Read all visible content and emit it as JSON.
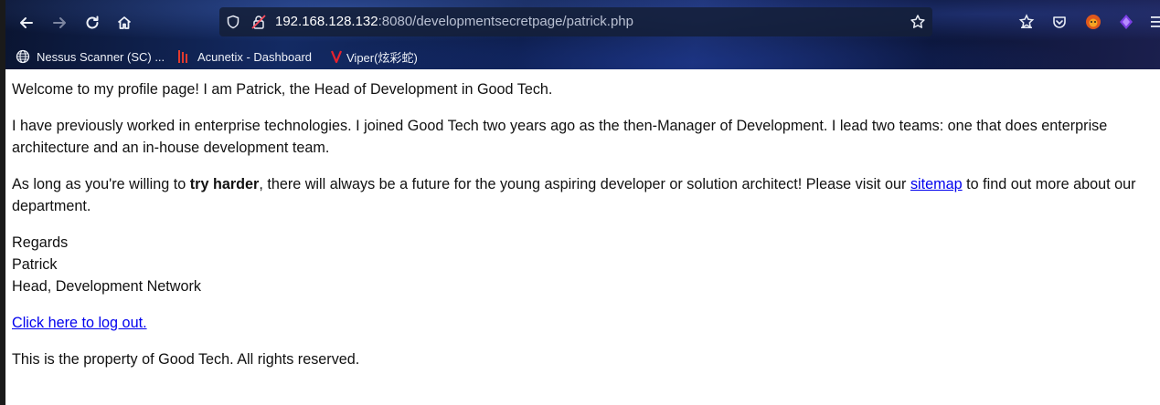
{
  "browser": {
    "url_host": "192.168.128.132",
    "url_rest": ":8080/developmentsecretpage/patrick.php",
    "bookmarks": [
      {
        "label": "Nessus Scanner (SC) ...",
        "icon": "globe-icon"
      },
      {
        "label": "Acunetix - Dashboard",
        "icon": "acunetix-icon"
      },
      {
        "label": "Viper(炫彩蛇)",
        "icon": "viper-icon"
      }
    ]
  },
  "page": {
    "welcome": "Welcome to my profile page! I am Patrick, the Head of Development in Good Tech.",
    "experience": "I have previously worked in enterprise technologies. I joined Good Tech two years ago as the then-Manager of Development. I lead two teams: one that does enterprise architecture and an in-house development team.",
    "aspire_pre": "As long as you're willing to ",
    "aspire_bold": "try harder",
    "aspire_mid": ", there will always be a future for the young aspiring developer or solution architect! Please visit our ",
    "sitemap_link": "sitemap",
    "aspire_post": " to find out more about our department.",
    "sign_regards": "Regards",
    "sign_name": "Patrick",
    "sign_title": "Head, Development Network",
    "logout_link": "Click here to log out.",
    "footer": "This is the property of Good Tech. All rights reserved."
  }
}
